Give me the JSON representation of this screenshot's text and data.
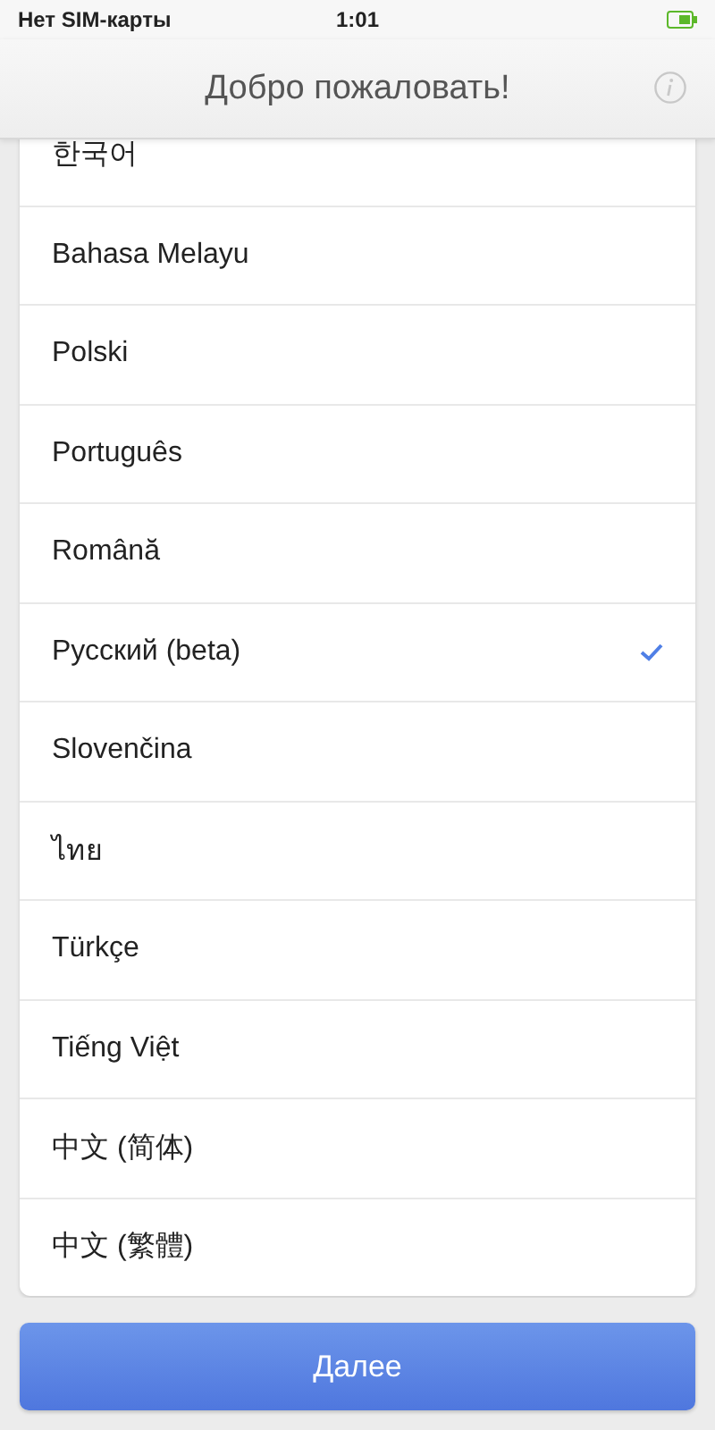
{
  "status_bar": {
    "carrier": "Нет SIM-карты",
    "time": "1:01"
  },
  "header": {
    "title": "Добро пожаловать!"
  },
  "languages": [
    {
      "label": "한국어",
      "selected": false
    },
    {
      "label": "Bahasa Melayu",
      "selected": false
    },
    {
      "label": "Polski",
      "selected": false
    },
    {
      "label": "Português",
      "selected": false
    },
    {
      "label": "Română",
      "selected": false
    },
    {
      "label": "Русский (beta)",
      "selected": true
    },
    {
      "label": "Slovenčina",
      "selected": false
    },
    {
      "label": "ไทย",
      "selected": false
    },
    {
      "label": "Türkçe",
      "selected": false
    },
    {
      "label": "Tiếng Việt",
      "selected": false
    },
    {
      "label": "中文 (简体)",
      "selected": false
    },
    {
      "label": "中文 (繁體)",
      "selected": false
    }
  ],
  "next_button": {
    "label": "Далее"
  }
}
